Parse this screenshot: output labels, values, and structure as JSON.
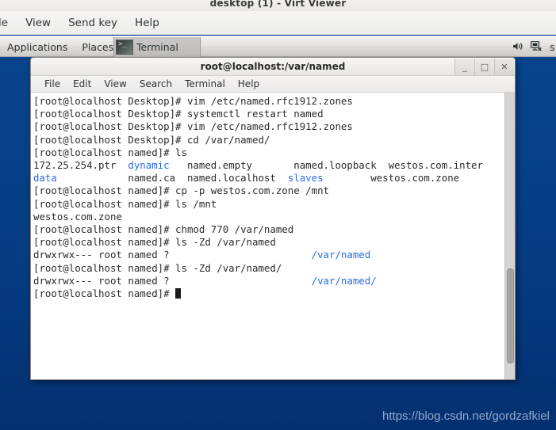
{
  "virt_viewer": {
    "window_title": "desktop (1) - Virt Viewer",
    "menu": [
      {
        "label": "le"
      },
      {
        "label": "View"
      },
      {
        "label": "Send key"
      },
      {
        "label": "Help"
      }
    ]
  },
  "panel": {
    "applications_label": "Applications",
    "places_label": "Places",
    "task": {
      "icon_prompt": ">_",
      "label": "Terminal"
    },
    "tray": {
      "volume_icon": "volume-icon",
      "network_icon": "network-disconnected-icon",
      "cut_letter": "s"
    }
  },
  "terminal": {
    "title": "root@localhost:/var/named",
    "window_buttons": {
      "minimize": "_",
      "maximize": "□",
      "close": "✕"
    },
    "menu": [
      {
        "label": "File"
      },
      {
        "label": "Edit"
      },
      {
        "label": "View"
      },
      {
        "label": "Search"
      },
      {
        "label": "Terminal"
      },
      {
        "label": "Help"
      }
    ],
    "lines": [
      {
        "segments": [
          {
            "t": "[root@localhost Desktop]# vim /etc/named.rfc1912.zones",
            "c": "normal"
          }
        ]
      },
      {
        "segments": [
          {
            "t": "[root@localhost Desktop]# systemctl restart named",
            "c": "normal"
          }
        ]
      },
      {
        "segments": [
          {
            "t": "[root@localhost Desktop]# vim /etc/named.rfc1912.zones",
            "c": "normal"
          }
        ]
      },
      {
        "segments": [
          {
            "t": "[root@localhost Desktop]# cd /var/named/",
            "c": "normal"
          }
        ]
      },
      {
        "segments": [
          {
            "t": "[root@localhost named]# ls",
            "c": "normal"
          }
        ]
      },
      {
        "segments": [
          {
            "t": "172.25.254.ptr  ",
            "c": "normal"
          },
          {
            "t": "dynamic",
            "c": "blue"
          },
          {
            "t": "   named.empty       named.loopback  westos.com.inter",
            "c": "normal"
          }
        ]
      },
      {
        "segments": [
          {
            "t": "data",
            "c": "blue"
          },
          {
            "t": "            named.ca  named.localhost  ",
            "c": "normal"
          },
          {
            "t": "slaves",
            "c": "blue"
          },
          {
            "t": "        westos.com.zone",
            "c": "normal"
          }
        ]
      },
      {
        "segments": [
          {
            "t": "[root@localhost named]# cp -p westos.com.zone /mnt",
            "c": "normal"
          }
        ]
      },
      {
        "segments": [
          {
            "t": "[root@localhost named]# ls /mnt",
            "c": "normal"
          }
        ]
      },
      {
        "segments": [
          {
            "t": "westos.com.zone",
            "c": "normal"
          }
        ]
      },
      {
        "segments": [
          {
            "t": "[root@localhost named]# chmod 770 /var/named",
            "c": "normal"
          }
        ]
      },
      {
        "segments": [
          {
            "t": "[root@localhost named]# ls -Zd /var/named",
            "c": "normal"
          }
        ]
      },
      {
        "segments": [
          {
            "t": "drwxrwx--- root named ?                        ",
            "c": "normal"
          },
          {
            "t": "/var/named",
            "c": "blue"
          }
        ]
      },
      {
        "segments": [
          {
            "t": "[root@localhost named]# ls -Zd /var/named/",
            "c": "normal"
          }
        ]
      },
      {
        "segments": [
          {
            "t": "drwxrwx--- root named ?                        ",
            "c": "normal"
          },
          {
            "t": "/var/named/",
            "c": "blue"
          }
        ]
      },
      {
        "segments": [
          {
            "t": "[root@localhost named]# ",
            "c": "normal"
          },
          {
            "t": "",
            "c": "cursor"
          }
        ]
      }
    ]
  },
  "watermark": "https://blog.csdn.net/gordzafkiel",
  "colors": {
    "desktop_blue": "#063d84",
    "terminal_text": "#2b2b2b",
    "terminal_dir_blue": "#2a6ae8",
    "watermark": "#9db4d2"
  }
}
